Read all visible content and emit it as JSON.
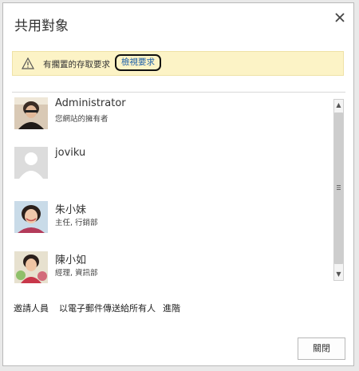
{
  "dialog": {
    "title": "共用對象",
    "close_icon": "close-icon"
  },
  "warning": {
    "icon": "warning-icon",
    "text": "有擱置的存取要求",
    "link_label": "檢視要求"
  },
  "people": [
    {
      "name": "Administrator",
      "role": "您網站的擁有者",
      "avatar": "photo"
    },
    {
      "name": "joviku",
      "role": "",
      "avatar": "placeholder"
    },
    {
      "name": "朱小妹",
      "role": "主任, 行銷部",
      "avatar": "photo"
    },
    {
      "name": "陳小如",
      "role": "經理, 資訊部",
      "avatar": "photo"
    }
  ],
  "actions": {
    "invite": "邀請人員",
    "email_all": "以電子郵件傳送給所有人",
    "advanced": "進階"
  },
  "footer": {
    "close_label": "關閉"
  },
  "colors": {
    "warning_bg": "#fcf3c6",
    "link": "#1a5ea8"
  }
}
